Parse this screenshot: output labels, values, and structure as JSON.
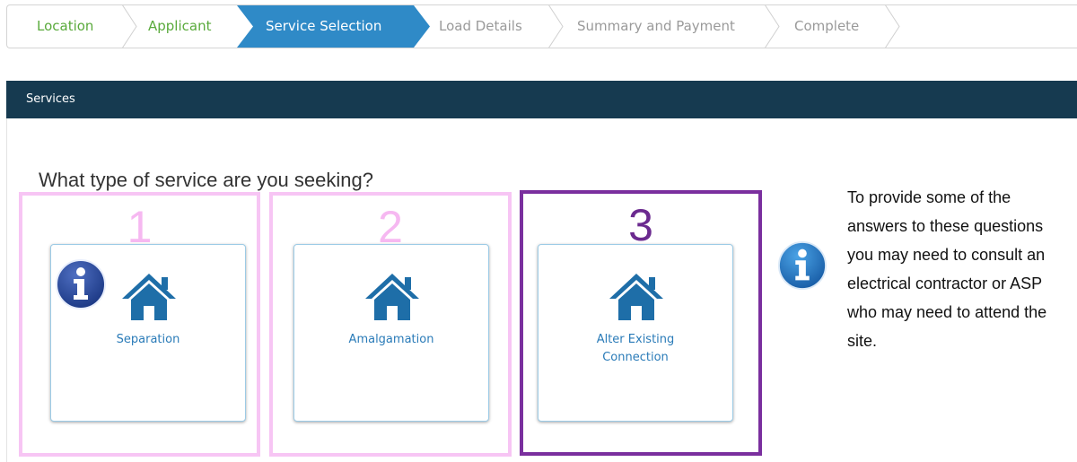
{
  "wizard": {
    "steps": [
      {
        "label": "Location",
        "state": "done"
      },
      {
        "label": "Applicant",
        "state": "done"
      },
      {
        "label": "Service Selection",
        "state": "active"
      },
      {
        "label": "Load Details",
        "state": "pending"
      },
      {
        "label": "Summary and Payment",
        "state": "pending"
      },
      {
        "label": "Complete",
        "state": "pending"
      }
    ],
    "colors": {
      "done": "#5aaa3c",
      "active_bg": "#2f8ac7",
      "pending": "#9a9a9a"
    }
  },
  "section": {
    "title": "Services",
    "bar_color": "#163a50"
  },
  "question": "What type of service are you seeking?",
  "highlights": [
    "1",
    "2",
    "3"
  ],
  "services": [
    {
      "label": "Separation",
      "icon": "house-icon"
    },
    {
      "label": "Amalgamation",
      "icon": "house-icon"
    },
    {
      "label": "Alter Existing Connection",
      "icon": "house-icon"
    }
  ],
  "info_text": {
    "lines": [
      "To provide some of the",
      "answers to these questions",
      "you may need to consult an",
      "electrical contractor or ASP",
      "who may need to attend the",
      "site."
    ]
  }
}
